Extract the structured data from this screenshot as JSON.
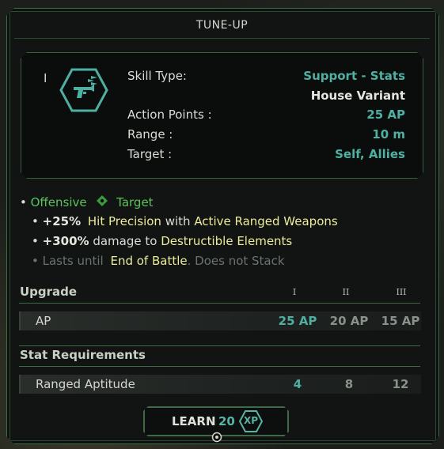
{
  "header": {
    "title": "TUNE-UP"
  },
  "skill": {
    "tier_mark": "I",
    "icon": "blaster-icon",
    "rows": [
      {
        "label": "Skill Type:",
        "value": "Support - Stats"
      },
      {
        "label": "",
        "value": "House Variant"
      },
      {
        "label": "Action Points :",
        "value": "25 AP"
      },
      {
        "label": "Range :",
        "value": "10 m"
      },
      {
        "label": "Target :",
        "value": "Self, Allies"
      }
    ]
  },
  "effects": {
    "tag1": "Offensive",
    "tag_icon": "diamond-target-icon",
    "tag2": "Target",
    "line1": {
      "amount": "+25%",
      "stat": "Hit Precision",
      "with": "with",
      "cond": "Active Ranged Weapons"
    },
    "line2": {
      "amount": "+300%",
      "text": "damage to",
      "cond": "Destructible Elements"
    },
    "line3": {
      "prefix": "Lasts until",
      "cond": "End of Battle",
      "suffix": ". Does not Stack"
    }
  },
  "upgrade": {
    "heading": "Upgrade",
    "levels": [
      "I",
      "II",
      "III"
    ],
    "row_label": "AP",
    "values": [
      "25 AP",
      "20 AP",
      "15 AP"
    ]
  },
  "requirements": {
    "heading": "Stat Requirements",
    "row_label": "Ranged Aptitude",
    "values": [
      "4",
      "8",
      "12"
    ]
  },
  "learn": {
    "label": "LEARN",
    "cost": "20",
    "currency": "XP"
  },
  "colors": {
    "accent_teal": "#4fb0a2",
    "accent_green": "#5bc25b",
    "highlight_yellow": "#ecec9a",
    "border_green": "#3f6a46"
  }
}
